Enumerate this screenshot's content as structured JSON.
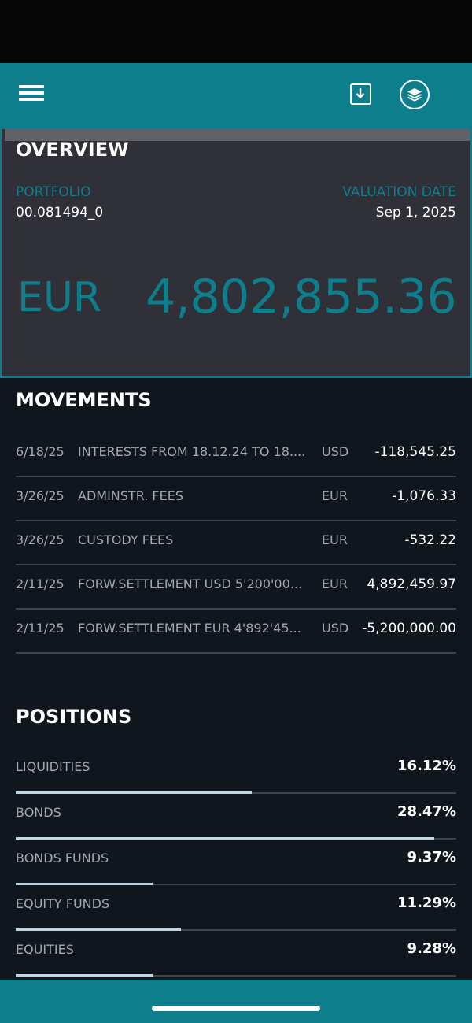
{
  "header": {
    "menu_icon": "hamburger-menu-icon",
    "download_icon": "download-icon",
    "layers_icon": "layers-icon"
  },
  "overview": {
    "title": "OVERVIEW",
    "portfolio_label": "PORTFOLIO",
    "portfolio_value": "00.081494_0",
    "valuation_label": "VALUATION DATE",
    "valuation_value": "Sep 1, 2025",
    "currency": "EUR",
    "amount": "4,802,855.36"
  },
  "movements": {
    "title": "MOVEMENTS",
    "rows": [
      {
        "date": "6/18/25",
        "desc": "INTERESTS FROM 18.12.24 TO 18....",
        "cur": "USD",
        "amt": "-118,545.25"
      },
      {
        "date": "3/26/25",
        "desc": "ADMINSTR. FEES",
        "cur": "EUR",
        "amt": "-1,076.33"
      },
      {
        "date": "3/26/25",
        "desc": "CUSTODY FEES",
        "cur": "EUR",
        "amt": "-532.22"
      },
      {
        "date": "2/11/25",
        "desc": "FORW.SETTLEMENT USD 5'200'00...",
        "cur": "EUR",
        "amt": "4,892,459.97"
      },
      {
        "date": "2/11/25",
        "desc": "FORW.SETTLEMENT EUR 4'892'45...",
        "cur": "USD",
        "amt": "-5,200,000.00"
      }
    ]
  },
  "positions": {
    "title": "POSITIONS",
    "rows": [
      {
        "label": "LIQUIDITIES",
        "pct": "16.12%",
        "fill": 0.535
      },
      {
        "label": "BONDS",
        "pct": "28.47%",
        "fill": 0.95
      },
      {
        "label": "BONDS FUNDS",
        "pct": "9.37%",
        "fill": 0.31
      },
      {
        "label": "EQUITY FUNDS",
        "pct": "11.29%",
        "fill": 0.375
      },
      {
        "label": "EQUITIES",
        "pct": "9.28%",
        "fill": 0.31
      }
    ]
  },
  "colors": {
    "accent": "#0d7f8c",
    "background": "#0f161d",
    "overview_bg": "#303039",
    "bar": "#b8d8e8"
  }
}
